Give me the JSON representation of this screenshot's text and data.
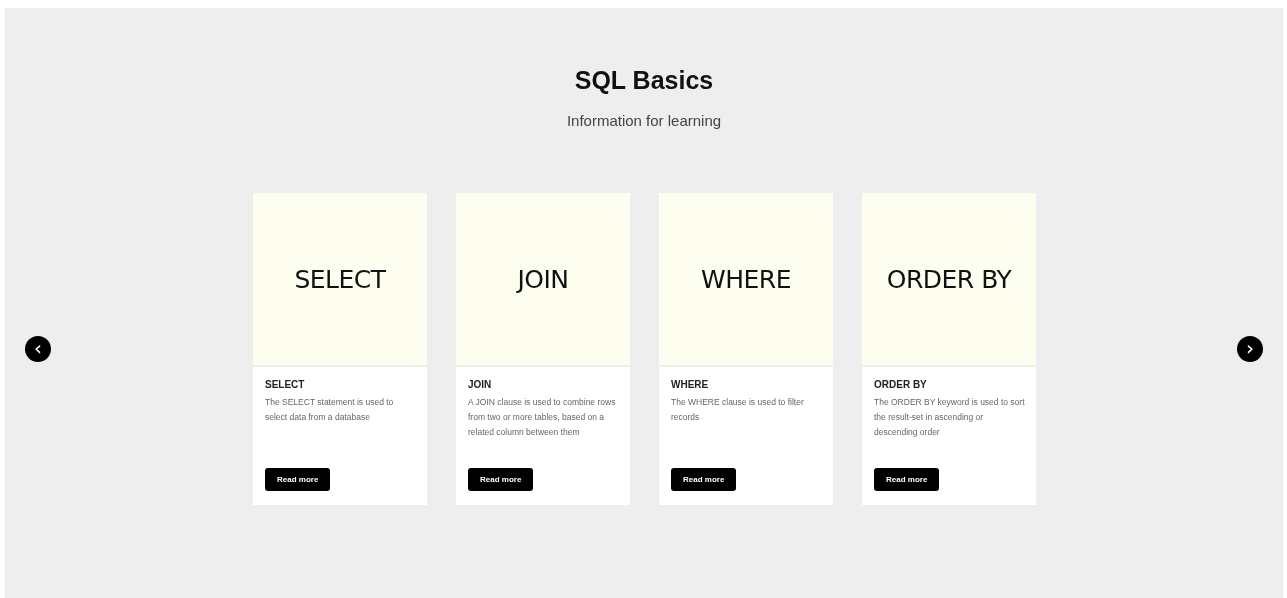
{
  "header": {
    "title": "SQL Basics",
    "subtitle": "Information for learning"
  },
  "carousel": {
    "prev": "‹",
    "next": "›"
  },
  "cards": [
    {
      "image_text": "SELECT",
      "title": "SELECT",
      "description": "The SELECT statement is used to select data from a database",
      "button": "Read more"
    },
    {
      "image_text": "JOIN",
      "title": "JOIN",
      "description": "A JOIN clause is used to combine rows from two or more tables, based on a related column between them",
      "button": "Read more"
    },
    {
      "image_text": "WHERE",
      "title": "WHERE",
      "description": "The WHERE clause is used to filter records",
      "button": "Read more"
    },
    {
      "image_text": "ORDER BY",
      "title": "ORDER BY",
      "description": "The ORDER BY keyword is used to sort the result-set in ascending or descending order",
      "button": "Read more"
    }
  ]
}
